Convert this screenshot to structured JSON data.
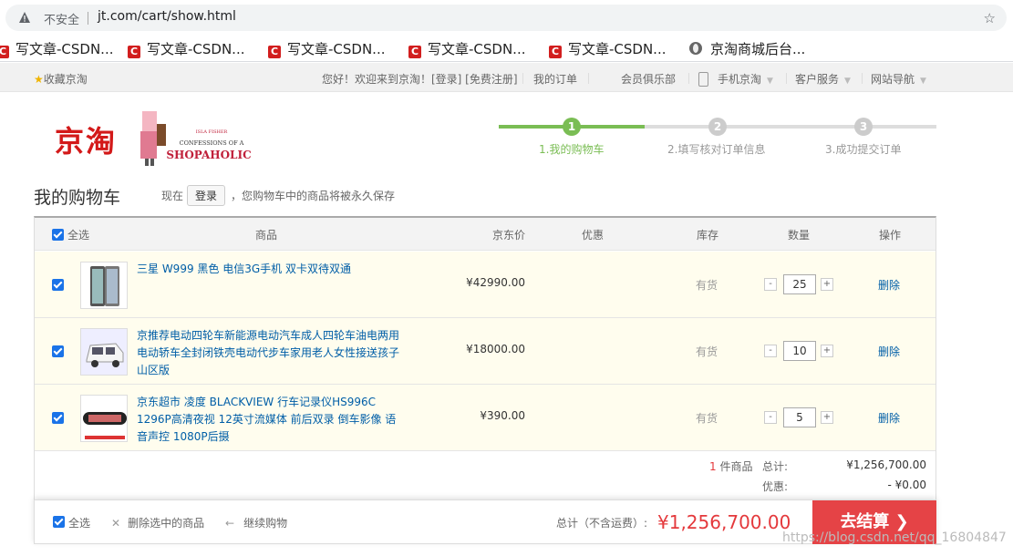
{
  "browser": {
    "security_label": "不安全",
    "url": "jt.com/cart/show.html",
    "bookmarks": [
      {
        "label": "写文章-CSDN...",
        "icon": "csdn-icon"
      },
      {
        "label": "写文章-CSDN...",
        "icon": "csdn-icon"
      },
      {
        "label": "写文章-CSDN...",
        "icon": "csdn-icon"
      },
      {
        "label": "写文章-CSDN...",
        "icon": "csdn-icon"
      },
      {
        "label": "写文章-CSDN...",
        "icon": "csdn-icon"
      },
      {
        "label": "京淘商城后台...",
        "icon": "globe-icon"
      }
    ]
  },
  "topnav": {
    "favorite": "收藏京淘",
    "welcome": "您好！欢迎来到京淘！[登录] [免费注册]",
    "orders": "我的订单",
    "club": "会员俱乐部",
    "mobile": "手机京淘",
    "service": "客户服务",
    "sitenav": "网站导航"
  },
  "header": {
    "logo": "京淘",
    "banner_line1": "ISLA FISHER",
    "banner_line2": "CONFESSIONS OF A",
    "banner_line3": "SHOPAHOLIC"
  },
  "steps": [
    {
      "num": "1",
      "label": "1.我的购物车",
      "active": true
    },
    {
      "num": "2",
      "label": "2.填写核对订单信息",
      "active": false
    },
    {
      "num": "3",
      "label": "3.成功提交订单",
      "active": false
    }
  ],
  "cart": {
    "title": "我的购物车",
    "login_prefix": "现在",
    "login_button": "登录",
    "login_suffix": "，您购物车中的商品将被永久保存",
    "columns": {
      "select_all": "全选",
      "product": "商品",
      "price": "京东价",
      "discount": "优惠",
      "stock": "库存",
      "quantity": "数量",
      "action": "操作"
    },
    "items": [
      {
        "name": "三星 W999 黑色 电信3G手机 双卡双待双通",
        "price": "¥42990.00",
        "stock": "有货",
        "qty": "25",
        "delete": "删除"
      },
      {
        "name": "京推荐电动四轮车新能源电动汽车成人四轮车油电两用电动轿车全封闭铁壳电动代步车家用老人女性接送孩子 山区版",
        "price": "¥18000.00",
        "stock": "有货",
        "qty": "10",
        "delete": "删除"
      },
      {
        "name": "京东超市 凌度 BLACKVIEW 行车记录仪HS996C 1296P高清夜视 12英寸流媒体 前后双录 倒车影像 语音声控 1080P后摄",
        "price": "¥390.00",
        "stock": "有货",
        "qty": "5",
        "delete": "删除"
      }
    ],
    "qty_minus": "-",
    "qty_plus": "+",
    "summary": {
      "count": "1",
      "count_unit": "件商品",
      "total_label": "总计:",
      "total_value": "¥1,256,700.00",
      "discount_label": "优惠:",
      "discount_value": "- ¥0.00"
    }
  },
  "footer": {
    "select_all": "全选",
    "delete_selected": "删除选中的商品",
    "continue": "继续购物",
    "total_label": "总计（不含运费）:",
    "total_value": "¥1,256,700.00",
    "checkout": "去结算"
  },
  "watermark": "https://blog.csdn.net/qq_16804847",
  "colors": {
    "accent": "#e4393c",
    "link": "#005ea7",
    "step_active": "#7abd54"
  }
}
